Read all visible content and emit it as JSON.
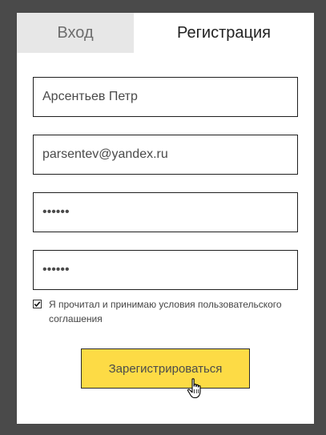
{
  "tabs": {
    "login_label": "Вход",
    "register_label": "Регистрация",
    "active": "register"
  },
  "form": {
    "name_value": "Арсентьев Петр",
    "email_value": "parsentev@yandex.ru",
    "password_value": "••••••",
    "password_confirm_value": "••••••",
    "agree_checked": true,
    "agree_label": "Я прочитал и принимаю условия пользовательского соглашения",
    "submit_label": "Зарегистрироваться"
  },
  "colors": {
    "background": "#4a4a4a",
    "card": "#ffffff",
    "inactive_tab": "#e7e7e7",
    "submit_button": "#fddb45"
  },
  "icons": {
    "checkbox": "check-icon",
    "cursor": "hand-pointer-cursor-icon"
  }
}
